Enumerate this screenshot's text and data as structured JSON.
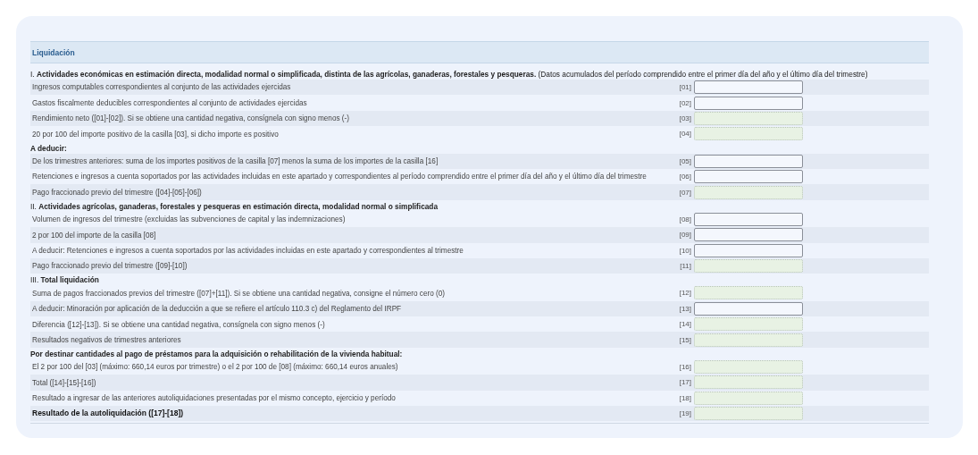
{
  "section_title": "Liquidación",
  "rows": [
    {
      "kind": "heading",
      "text": "I. **Actividades económicas en estimación directa, modalidad normal o simplificada, distinta de las agrícolas, ganaderas, forestales y pesqueras.** (Datos acumulados del período comprendido entre el primer día del año y el último día del trimestre)"
    },
    {
      "kind": "field",
      "text": "Ingresos computables correspondientes al conjunto de las actividades ejercidas",
      "code": "[01]",
      "readonly": false
    },
    {
      "kind": "field",
      "text": "Gastos fiscalmente deducibles correspondientes al conjunto de actividades ejercidas",
      "code": "[02]",
      "readonly": false
    },
    {
      "kind": "field",
      "text": "Rendimiento neto ([01]-[02]). Si se obtiene una cantidad negativa, consígnela con signo menos (-)",
      "code": "[03]",
      "readonly": true
    },
    {
      "kind": "field",
      "text": "20 por 100 del importe positivo de la casilla [03], si dicho importe es positivo",
      "code": "[04]",
      "readonly": true
    },
    {
      "kind": "heading",
      "text": "**A deducir:**"
    },
    {
      "kind": "field",
      "text": "De los trimestres anteriores: suma de los importes positivos de la casilla [07] menos la suma de los importes de la casilla [16]",
      "code": "[05]",
      "readonly": false
    },
    {
      "kind": "field",
      "text": "Retenciones e ingresos a cuenta soportados por las actividades incluidas en este apartado y correspondientes al período comprendido entre el primer día del año y el último día del trimestre",
      "code": "[06]",
      "readonly": false
    },
    {
      "kind": "field",
      "text": "Pago fraccionado previo del trimestre ([04]-[05]-[06])",
      "code": "[07]",
      "readonly": true
    },
    {
      "kind": "heading",
      "text": "II. **Actividades agrícolas, ganaderas, forestales y pesqueras en estimación directa, modalidad normal o simplificada**"
    },
    {
      "kind": "field",
      "text": "Volumen de ingresos del trimestre (excluidas las subvenciones de capital y las indemnizaciones)",
      "code": "[08]",
      "readonly": false
    },
    {
      "kind": "field",
      "text": "2 por 100 del importe de la casilla [08]",
      "code": "[09]",
      "readonly": false
    },
    {
      "kind": "field",
      "text": "A deducir: Retenciones e ingresos a cuenta soportados por las actividades incluidas en este apartado y correspondientes al trimestre",
      "code": "[10]",
      "readonly": false
    },
    {
      "kind": "field",
      "text": "Pago fraccionado previo del trimestre ([09]-[10])",
      "code": "[11]",
      "readonly": true
    },
    {
      "kind": "heading",
      "text": "III. **Total liquidación**"
    },
    {
      "kind": "field",
      "text": "Suma de pagos fraccionados previos del trimestre ([07]+[11]). Si se obtiene una cantidad negativa, consigne el número cero (0)",
      "code": "[12]",
      "readonly": true
    },
    {
      "kind": "field",
      "text": "A deducir: Minoración por aplicación de la deducción a que se refiere el artículo 110.3 c) del Reglamento del IRPF",
      "code": "[13]",
      "readonly": false
    },
    {
      "kind": "field",
      "text": "Diferencia ([12]-[13]). Si se obtiene una cantidad negativa, consígnela con signo menos (-)",
      "code": "[14]",
      "readonly": true
    },
    {
      "kind": "field",
      "text": "Resultados negativos de trimestres anteriores",
      "code": "[15]",
      "readonly": true
    },
    {
      "kind": "heading",
      "text": "**Por destinar cantidades al pago de préstamos para la adquisición o rehabilitación de la vivienda habitual:**"
    },
    {
      "kind": "field",
      "text": "El 2 por 100 del [03] (máximo: 660,14 euros por trimestre) o el 2 por 100 de [08] (máximo: 660,14 euros anuales)",
      "code": "[16]",
      "readonly": true
    },
    {
      "kind": "field",
      "text": "Total ([14]-[15]-[16])",
      "code": "[17]",
      "readonly": true
    },
    {
      "kind": "field",
      "text": "Resultado a ingresar de las anteriores autoliquidaciones presentadas por el mismo concepto, ejercicio y período",
      "code": "[18]",
      "readonly": true
    },
    {
      "kind": "field",
      "text": "Resultado de la autoliquidación ([17]-[18])",
      "code": "[19]",
      "readonly": true,
      "bold": true
    }
  ]
}
